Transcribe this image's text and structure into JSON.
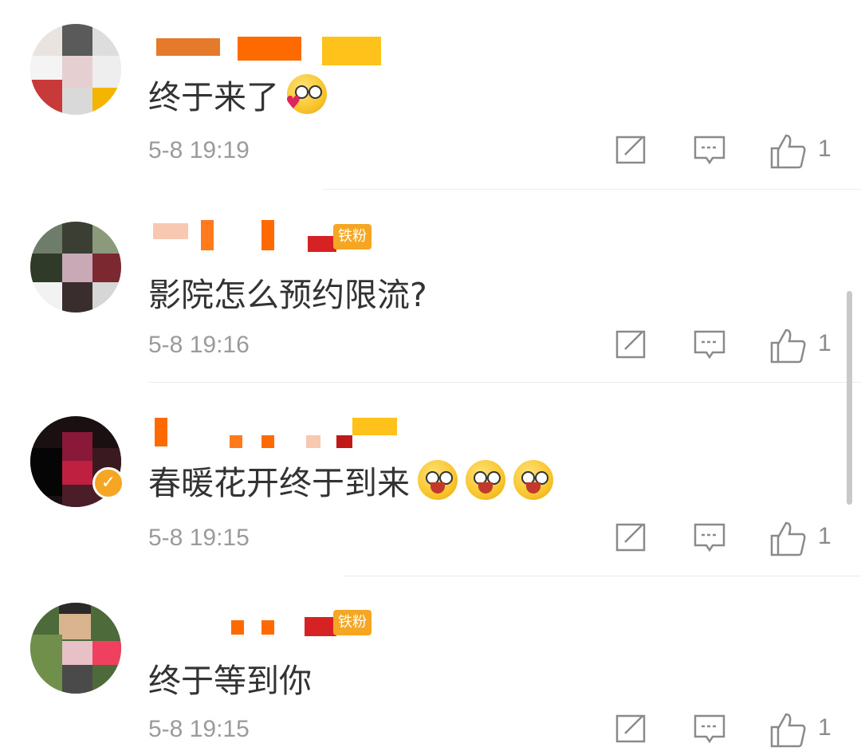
{
  "comments": [
    {
      "text": "终于来了",
      "time": "5-8 19:19",
      "likes": "1",
      "emojis": [
        "heart-kiss-emoji"
      ],
      "fan_badge": null,
      "verified": false
    },
    {
      "text": "影院怎么预约限流?",
      "time": "5-8 19:16",
      "likes": "1",
      "emojis": [],
      "fan_badge": "铁粉",
      "verified": false
    },
    {
      "text": "春暖花开终于到来",
      "time": "5-8 19:15",
      "likes": "1",
      "emojis": [
        "hug-emoji",
        "hug-emoji",
        "hug-emoji"
      ],
      "fan_badge": null,
      "verified": true
    },
    {
      "text": "终于等到你",
      "time": "5-8 19:15",
      "likes": "1",
      "emojis": [],
      "fan_badge": "铁粉",
      "verified": false
    }
  ],
  "icons": {
    "share": "share-icon",
    "reply": "reply-icon",
    "like": "like-icon"
  },
  "colors": {
    "text": "#333333",
    "meta": "#9b9b9b",
    "badge": "#f5a623"
  }
}
